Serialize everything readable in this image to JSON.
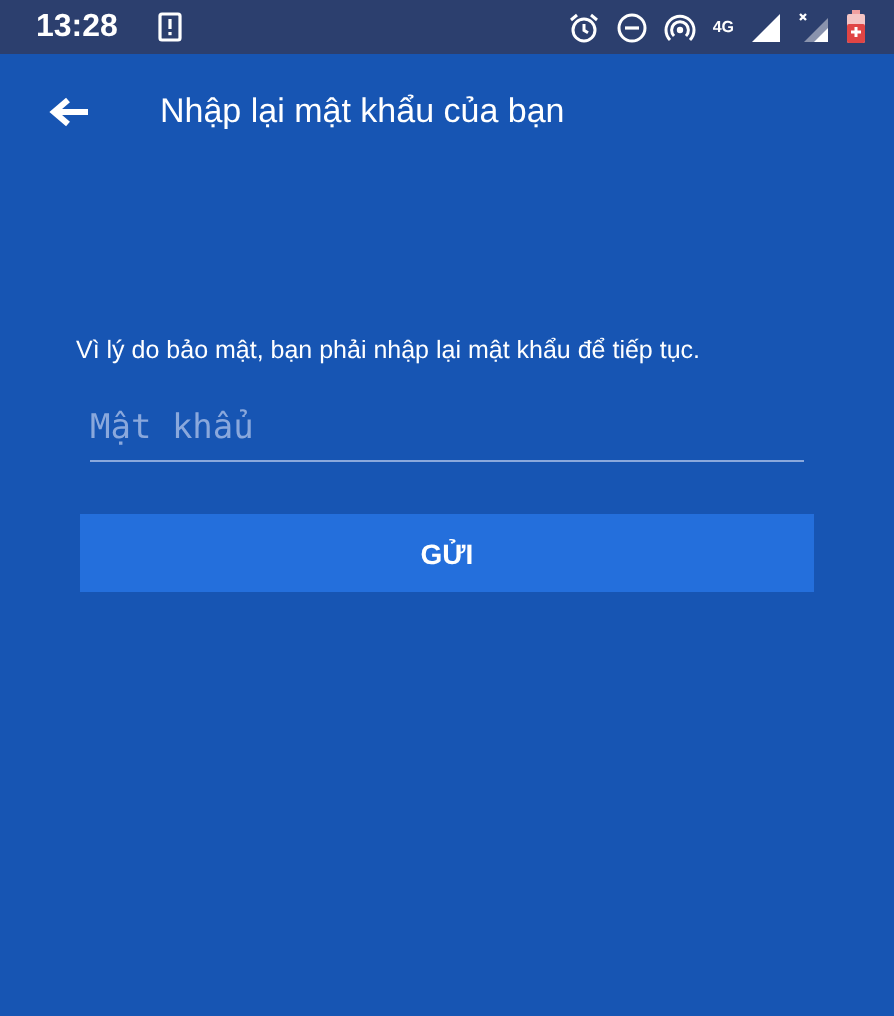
{
  "status_bar": {
    "time": "13:28",
    "network": "4G"
  },
  "header": {
    "title": "Nhập lại mật khẩu của bạn"
  },
  "message": "Vì lý do bảo mật, bạn phải nhập lại mật khẩu để tiếp tục.",
  "password_field": {
    "placeholder": "Mật khẩu"
  },
  "buttons": [
    "GỬI"
  ]
}
